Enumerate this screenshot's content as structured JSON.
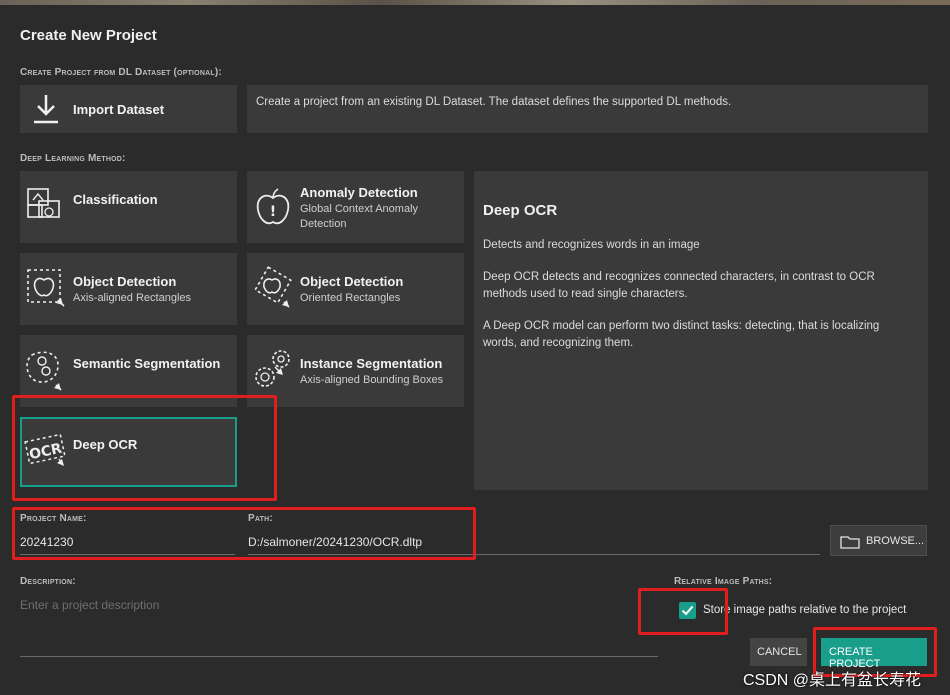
{
  "dialog": {
    "title": "Create New Project"
  },
  "import_section": {
    "label": "Create Project from DL Dataset (optional):",
    "button_label": "Import Dataset",
    "description": "Create a project from an existing DL Dataset. The dataset defines the supported DL methods."
  },
  "method_section": {
    "label": "Deep Learning Method:"
  },
  "methods": [
    {
      "name": "Classification",
      "sub": "",
      "icon": "classification-icon"
    },
    {
      "name": "Anomaly Detection",
      "sub": "Global Context Anomaly Detection",
      "icon": "anomaly-detection-icon"
    },
    {
      "name": "Object Detection",
      "sub": "Axis-aligned Rectangles",
      "icon": "object-detection-axis-icon"
    },
    {
      "name": "Object Detection",
      "sub": "Oriented Rectangles",
      "icon": "object-detection-oriented-icon"
    },
    {
      "name": "Semantic Segmentation",
      "sub": "",
      "icon": "semantic-segmentation-icon"
    },
    {
      "name": "Instance Segmentation",
      "sub": "Axis-aligned Bounding Boxes",
      "icon": "instance-segmentation-icon"
    },
    {
      "name": "Deep OCR",
      "sub": "",
      "icon": "ocr-icon",
      "selected": true
    }
  ],
  "method_description": {
    "title": "Deep OCR",
    "paragraphs": [
      "Detects and recognizes words in an image",
      "Deep OCR detects and recognizes connected characters, in contrast to OCR methods used to read single characters.",
      "A Deep OCR model can perform two distinct tasks: detecting, that is localizing words, and recognizing them."
    ]
  },
  "project_name": {
    "label": "Project Name:",
    "value": "20241230"
  },
  "path": {
    "label": "Path:",
    "value": "D:/salmoner/20241230/OCR.dltp"
  },
  "browse_button": {
    "label": "BROWSE...",
    "icon": "folder-icon"
  },
  "description": {
    "label": "Description:",
    "placeholder": "Enter a project description"
  },
  "relative_paths": {
    "label": "Relative Image Paths:",
    "checkbox_label": "Store image paths relative to the project",
    "checked": true
  },
  "buttons": {
    "cancel": "CANCEL",
    "create": "CREATE PROJECT"
  },
  "watermark": "CSDN @桌上有盆长寿花",
  "colors": {
    "accent": "#1a9e8c",
    "background": "#2b2b2b",
    "card": "#3a3a3a",
    "highlight_box": "#e01e1e"
  }
}
